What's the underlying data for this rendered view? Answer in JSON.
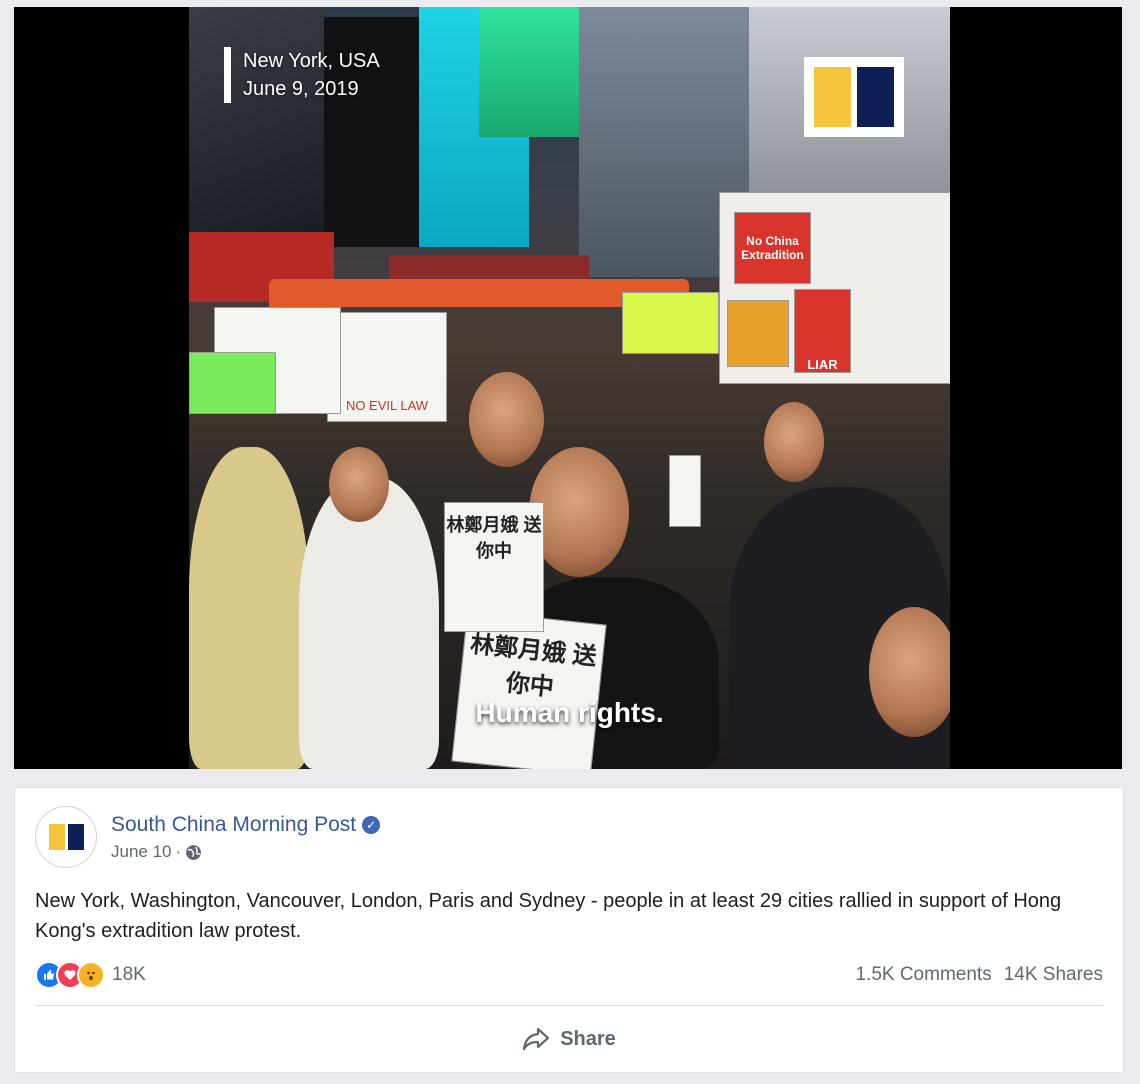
{
  "video": {
    "location_caption": "New York, USA",
    "date_caption": "June 9, 2019",
    "subtitle": "Human rights.",
    "signs": {
      "no_china_extradition": "No China Extradition",
      "liar": "LIAR",
      "no_evil_law": "NO EVIL LAW",
      "lam_sign": "林鄭月娥 送你中"
    },
    "brand_colors": {
      "yellow": "#f5c53b",
      "navy": "#0e1f56"
    }
  },
  "post": {
    "page_name": "South China Morning Post",
    "verified_icon": "verified-badge-icon",
    "date": "June 10",
    "separator": "·",
    "audience_icon": "globe-icon",
    "text": "New York, Washington, Vancouver, London, Paris and Sydney - people in at least 29 cities rallied in support of Hong Kong's extradition law protest.",
    "reactions": {
      "icons": [
        "like-reaction-icon",
        "love-reaction-icon",
        "wow-reaction-icon"
      ],
      "count": "18K"
    },
    "comments": "1.5K Comments",
    "shares": "14K Shares",
    "share_button": "Share",
    "link_color": "#385898"
  }
}
